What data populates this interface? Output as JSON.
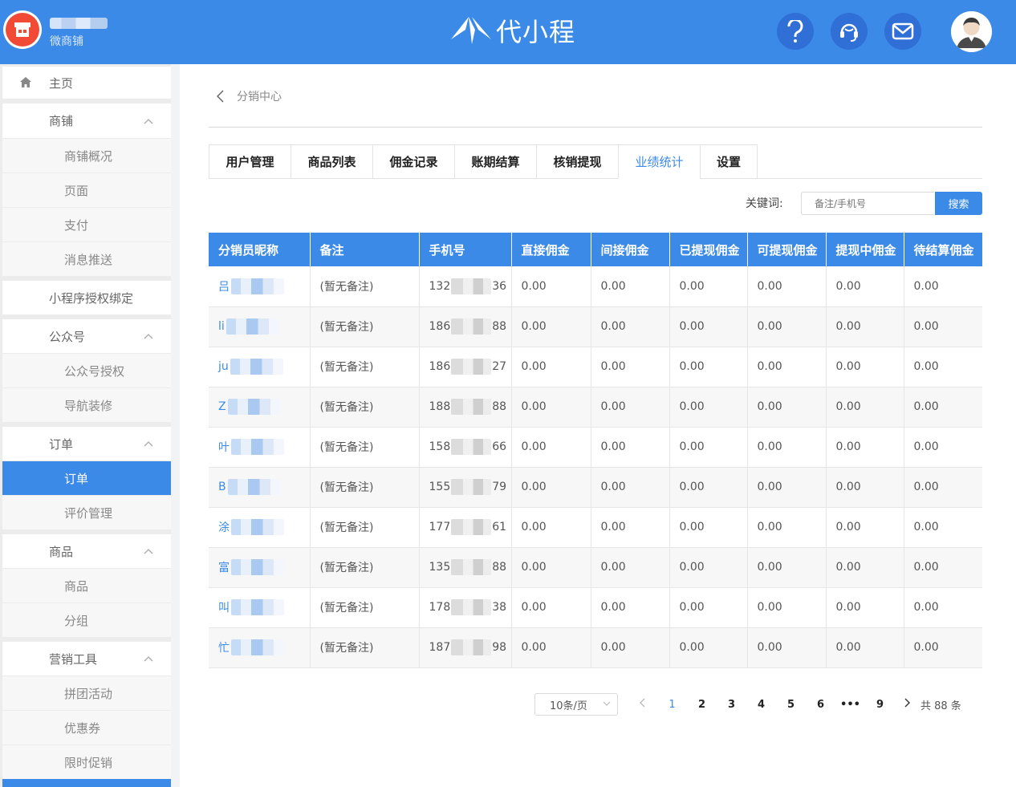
{
  "header": {
    "shop_type": "微商铺",
    "logo_text": "代小程"
  },
  "sidebar": {
    "items": [
      {
        "label": "主页",
        "level": 1,
        "icon": "home-icon"
      },
      {
        "label": "商铺",
        "level": 1,
        "expandable": true
      },
      {
        "label": "商铺概况",
        "level": 2
      },
      {
        "label": "页面",
        "level": 2
      },
      {
        "label": "支付",
        "level": 2
      },
      {
        "label": "消息推送",
        "level": 2
      },
      {
        "label": "小程序授权绑定",
        "level": 1
      },
      {
        "label": "公众号",
        "level": 1,
        "expandable": true
      },
      {
        "label": "公众号授权",
        "level": 2
      },
      {
        "label": "导航装修",
        "level": 2
      },
      {
        "label": "订单",
        "level": 1,
        "expandable": true
      },
      {
        "label": "订单",
        "level": 2,
        "active": true
      },
      {
        "label": "评价管理",
        "level": 2
      },
      {
        "label": "商品",
        "level": 1,
        "expandable": true
      },
      {
        "label": "商品",
        "level": 2
      },
      {
        "label": "分组",
        "level": 2
      },
      {
        "label": "营销工具",
        "level": 1,
        "expandable": true
      },
      {
        "label": "拼团活动",
        "level": 2
      },
      {
        "label": "优惠券",
        "level": 2
      },
      {
        "label": "限时促销",
        "level": 2
      }
    ]
  },
  "breadcrumb": {
    "label": "分销中心"
  },
  "tabs": [
    "用户管理",
    "商品列表",
    "佣金记录",
    "账期结算",
    "核销提现",
    "业绩统计",
    "设置"
  ],
  "active_tab": "业绩统计",
  "search": {
    "label": "关键词:",
    "placeholder": "备注/手机号",
    "button": "搜索"
  },
  "table": {
    "headers": [
      "分销员昵称",
      "备注",
      "手机号",
      "直接佣金",
      "间接佣金",
      "已提现佣金",
      "可提现佣金",
      "提现中佣金",
      "待结算佣金"
    ],
    "rows": [
      {
        "name_initial": "吕",
        "remark": "(暂无备注)",
        "phone_prefix": "132",
        "phone_suffix": "36",
        "direct": "0.00",
        "indirect": "0.00",
        "withdrawn": "0.00",
        "withdrawable": "0.00",
        "withdrawing": "0.00",
        "pending": "0.00"
      },
      {
        "name_initial": "li",
        "remark": "(暂无备注)",
        "phone_prefix": "186",
        "phone_suffix": "88",
        "direct": "0.00",
        "indirect": "0.00",
        "withdrawn": "0.00",
        "withdrawable": "0.00",
        "withdrawing": "0.00",
        "pending": "0.00"
      },
      {
        "name_initial": "ju",
        "remark": "(暂无备注)",
        "phone_prefix": "186",
        "phone_suffix": "27",
        "direct": "0.00",
        "indirect": "0.00",
        "withdrawn": "0.00",
        "withdrawable": "0.00",
        "withdrawing": "0.00",
        "pending": "0.00"
      },
      {
        "name_initial": "Z",
        "remark": "(暂无备注)",
        "phone_prefix": "188",
        "phone_suffix": "88",
        "direct": "0.00",
        "indirect": "0.00",
        "withdrawn": "0.00",
        "withdrawable": "0.00",
        "withdrawing": "0.00",
        "pending": "0.00"
      },
      {
        "name_initial": "叶",
        "remark": "(暂无备注)",
        "phone_prefix": "158",
        "phone_suffix": "66",
        "direct": "0.00",
        "indirect": "0.00",
        "withdrawn": "0.00",
        "withdrawable": "0.00",
        "withdrawing": "0.00",
        "pending": "0.00"
      },
      {
        "name_initial": "B",
        "remark": "(暂无备注)",
        "phone_prefix": "155",
        "phone_suffix": "79",
        "direct": "0.00",
        "indirect": "0.00",
        "withdrawn": "0.00",
        "withdrawable": "0.00",
        "withdrawing": "0.00",
        "pending": "0.00"
      },
      {
        "name_initial": "涂",
        "remark": "(暂无备注)",
        "phone_prefix": "177",
        "phone_suffix": "61",
        "direct": "0.00",
        "indirect": "0.00",
        "withdrawn": "0.00",
        "withdrawable": "0.00",
        "withdrawing": "0.00",
        "pending": "0.00"
      },
      {
        "name_initial": "富",
        "remark": "(暂无备注)",
        "phone_prefix": "135",
        "phone_suffix": "88",
        "direct": "0.00",
        "indirect": "0.00",
        "withdrawn": "0.00",
        "withdrawable": "0.00",
        "withdrawing": "0.00",
        "pending": "0.00"
      },
      {
        "name_initial": "叫",
        "remark": "(暂无备注)",
        "phone_prefix": "178",
        "phone_suffix": "38",
        "direct": "0.00",
        "indirect": "0.00",
        "withdrawn": "0.00",
        "withdrawable": "0.00",
        "withdrawing": "0.00",
        "pending": "0.00"
      },
      {
        "name_initial": "忙",
        "remark": "(暂无备注)",
        "phone_prefix": "187",
        "phone_suffix": "98",
        "direct": "0.00",
        "indirect": "0.00",
        "withdrawn": "0.00",
        "withdrawable": "0.00",
        "withdrawing": "0.00",
        "pending": "0.00"
      }
    ]
  },
  "pagination": {
    "page_size": "10条/页",
    "pages": [
      "1",
      "2",
      "3",
      "4",
      "5",
      "6",
      "•••",
      "9"
    ],
    "current": "1",
    "total": "共 88 条"
  },
  "colors": {
    "primary": "#3b8ae8",
    "shop_avatar": "#f24b35"
  }
}
